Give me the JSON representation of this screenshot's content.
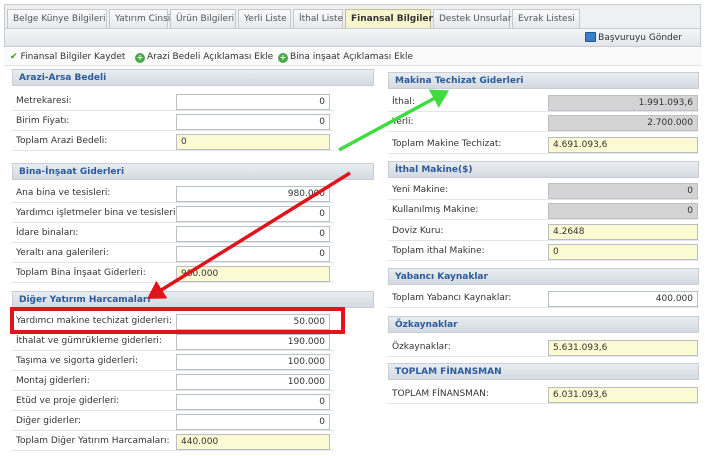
{
  "tabs": [
    {
      "label": "Belge Künye Bilgileri"
    },
    {
      "label": "Yatırım Cinsi"
    },
    {
      "label": "Ürün Bilgileri"
    },
    {
      "label": "Yerli Liste"
    },
    {
      "label": "İthal Liste"
    },
    {
      "label": "Finansal Bilgiler"
    },
    {
      "label": "Destek Unsurları"
    },
    {
      "label": "Evrak Listesi"
    }
  ],
  "header": {
    "submit_label": "Başvuruyu Gönder"
  },
  "actions": {
    "save": "Finansal Bilgiler Kaydet",
    "add_land": "Arazi Bedeli Açıklaması Ekle",
    "add_building": "Bina inşaat Açıklaması Ekle"
  },
  "left": {
    "land": {
      "title": "Arazi-Arsa Bedeli",
      "rows": [
        {
          "label": "Metrekaresi:",
          "value": "0"
        },
        {
          "label": "Birim Fiyatı:",
          "value": "0"
        },
        {
          "label": "Toplam Arazi Bedeli:",
          "value": "0"
        }
      ]
    },
    "building": {
      "title": "Bina-İnşaat Giderleri",
      "rows": [
        {
          "label": "Ana bina ve tesisleri:",
          "value": "980.000"
        },
        {
          "label": "Yardımcı işletmeler bina ve tesisleri:",
          "value": "0"
        },
        {
          "label": "İdare binaları:",
          "value": "0"
        },
        {
          "label": "Yeraltı ana galerileri:",
          "value": "0"
        },
        {
          "label": "Toplam Bina İnşaat Giderleri:",
          "value": "980.000"
        }
      ]
    },
    "other": {
      "title": "Diğer Yatırım Harcamaları",
      "rows": [
        {
          "label": "Yardımcı makine techizat giderleri:",
          "value": "50.000"
        },
        {
          "label": "İthalat ve gümrükleme giderleri:",
          "value": "190.000"
        },
        {
          "label": "Taşıma ve sigorta giderleri:",
          "value": "100.000"
        },
        {
          "label": "Montaj giderleri:",
          "value": "100.000"
        },
        {
          "label": "Etüd ve proje giderleri:",
          "value": "0"
        },
        {
          "label": "Diğer giderler:",
          "value": "0"
        },
        {
          "label": "Toplam Diğer Yatırım Harcamaları:",
          "value": "440.000"
        }
      ]
    }
  },
  "right": {
    "machine": {
      "title": "Makina Techizat Giderleri",
      "rows": [
        {
          "label": "İthal:",
          "value": "1.991.093,6"
        },
        {
          "label": "Yerli:",
          "value": "2.700.000"
        },
        {
          "label": "Toplam Makine Techizat:",
          "value": "4.691.093,6"
        }
      ]
    },
    "import_machine": {
      "title": "İthal Makine($)",
      "rows": [
        {
          "label": "Yeni Makine:",
          "value": "0"
        },
        {
          "label": "Kullanılmış Makine:",
          "value": "0"
        },
        {
          "label": "Doviz Kuru:",
          "value": "4.2648"
        },
        {
          "label": "Toplam ithal Makine:",
          "value": "0"
        }
      ]
    },
    "foreign": {
      "title": "Yabancı Kaynaklar",
      "rows": [
        {
          "label": "Toplam Yabancı Kaynaklar:",
          "value": "400.000"
        }
      ]
    },
    "equity": {
      "title": "Özkaynaklar",
      "rows": [
        {
          "label": "Özkaynaklar:",
          "value": "5.631.093,6"
        }
      ]
    },
    "total": {
      "title": "TOPLAM FİNANSMAN",
      "rows": [
        {
          "label": "TOPLAM FİNANSMAN:",
          "value": "6.031.093,6"
        }
      ]
    }
  },
  "colors": {
    "highlight_box": "#e0151b",
    "arrow_red": "#e0151b",
    "arrow_green": "#3fdc3f",
    "section_title": "#2b5b9a",
    "yellow_field": "#fcfad2",
    "gray_field": "#d4d4d4"
  }
}
